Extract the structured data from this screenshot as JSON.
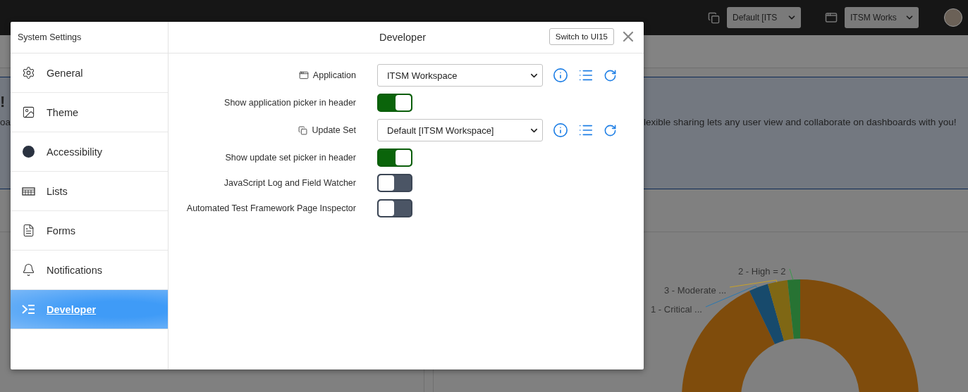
{
  "top_bar": {
    "update_set_select": "Default [ITS",
    "application_select": "ITSM Works"
  },
  "banner": {
    "heading": "!",
    "text_left": "oa",
    "text_right": "lexible sharing lets any user view and collaborate on dashboards with you!"
  },
  "dashboard_chart": {
    "labels": [
      {
        "text": "2 - High = 2",
        "color": "#3a9a4c"
      },
      {
        "text": "3 - Moderate ...",
        "color": "#c9a227"
      },
      {
        "text": "1 - Critical ...",
        "color": "#2a78b0"
      }
    ]
  },
  "dialog": {
    "title": "System Settings",
    "heading": "Developer",
    "switch_button": "Switch to UI15",
    "sidebar": {
      "items": [
        {
          "label": "General",
          "selected": false
        },
        {
          "label": "Theme",
          "selected": false
        },
        {
          "label": "Accessibility",
          "selected": false
        },
        {
          "label": "Lists",
          "selected": false
        },
        {
          "label": "Forms",
          "selected": false
        },
        {
          "label": "Notifications",
          "selected": false
        },
        {
          "label": "Developer",
          "selected": true
        }
      ]
    },
    "settings": [
      {
        "kind": "select",
        "label": "Application",
        "value": "ITSM Workspace"
      },
      {
        "kind": "toggle",
        "label": "Show application picker in header",
        "on": true
      },
      {
        "kind": "select",
        "label": "Update Set",
        "value": "Default [ITSM Workspace]"
      },
      {
        "kind": "toggle",
        "label": "Show update set picker in header",
        "on": true
      },
      {
        "kind": "toggle",
        "label": "JavaScript Log and Field Watcher",
        "on": false
      },
      {
        "kind": "toggle",
        "label": "Automated Test Framework Page Inspector",
        "on": false
      }
    ]
  }
}
